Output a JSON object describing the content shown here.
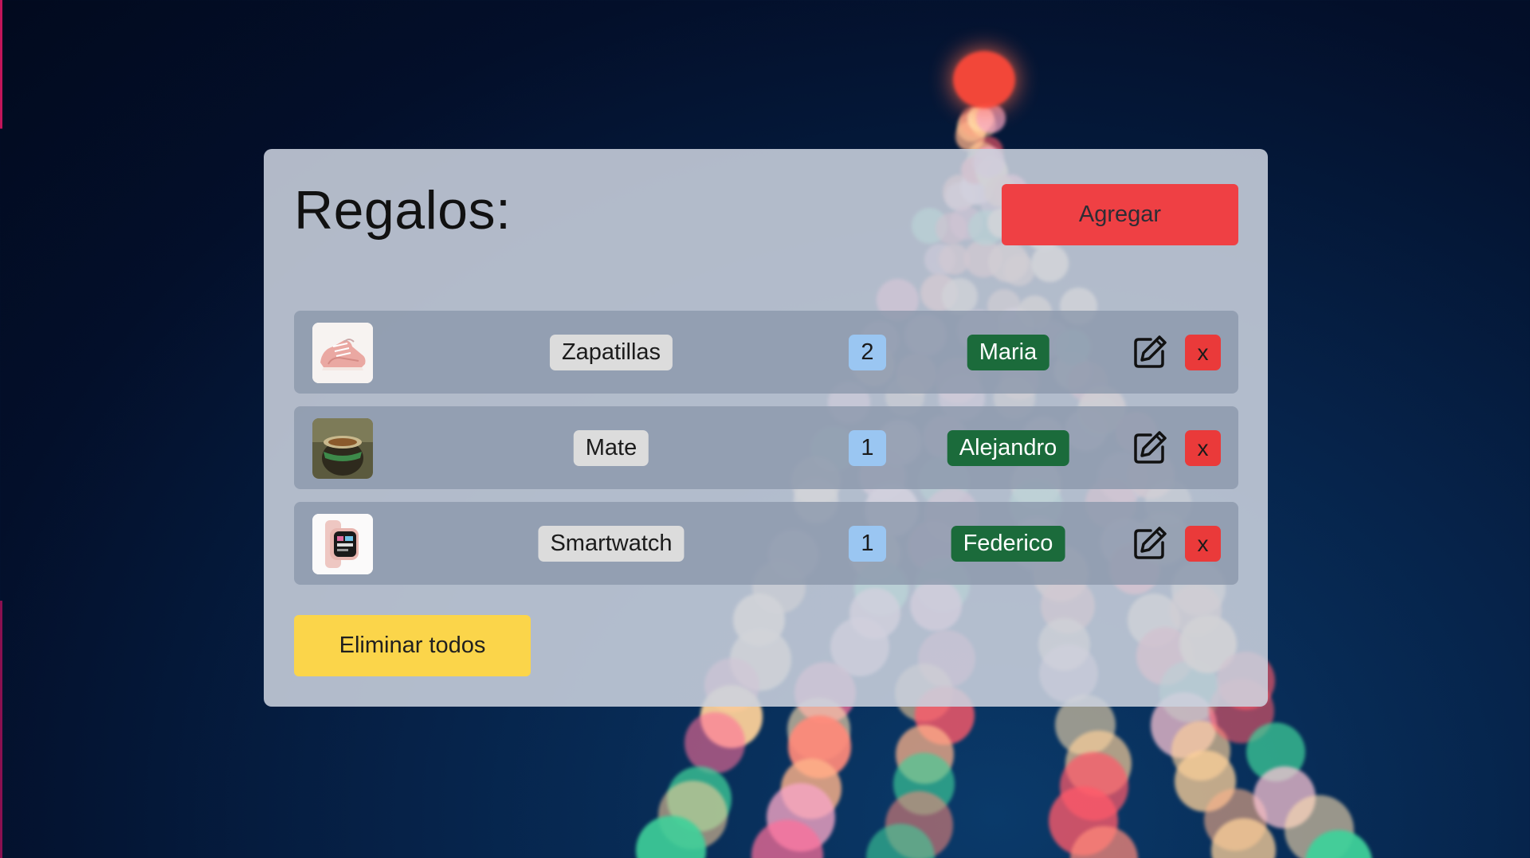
{
  "header": {
    "title": "Regalos:",
    "add_label": "Agregar"
  },
  "gifts": [
    {
      "name": "Zapatillas",
      "quantity": "2",
      "recipient": "Maria",
      "image": "sneakers-image"
    },
    {
      "name": "Mate",
      "quantity": "1",
      "recipient": "Alejandro",
      "image": "mate-image"
    },
    {
      "name": "Smartwatch",
      "quantity": "1",
      "recipient": "Federico",
      "image": "smartwatch-image"
    }
  ],
  "actions": {
    "delete_label": "x",
    "clear_all_label": "Eliminar todos"
  },
  "colors": {
    "add_button": "#ef4044",
    "clear_button": "#fbd54a",
    "quantity_badge": "#9ac6f2",
    "recipient_badge": "#1b6b3b",
    "delete_button": "#ea3a3a"
  }
}
